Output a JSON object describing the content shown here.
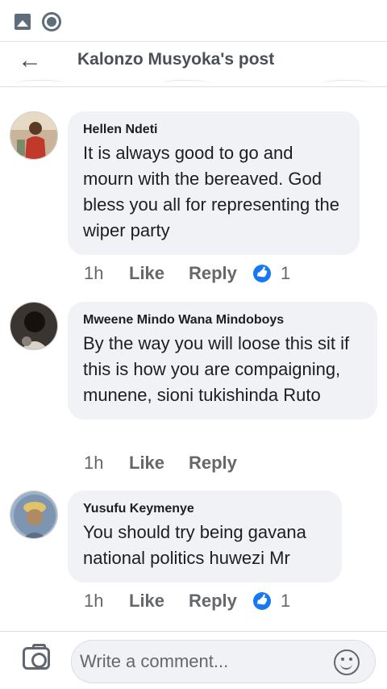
{
  "status_bar": {
    "icons": [
      "gallery-icon",
      "screen-record-icon"
    ]
  },
  "header": {
    "back_icon": "back-arrow-icon",
    "title": "Kalonzo Musyoka's post"
  },
  "comments": [
    {
      "author": "Hellen Ndeti",
      "text": "It is always good to go and mourn with the bereaved. God bless you all for representing the wiper party",
      "time": "1h",
      "like_label": "Like",
      "reply_label": "Reply",
      "reactions": "1"
    },
    {
      "author": "Mweene Mindo Wana Mindoboys",
      "text": "By the way you will loose this sit if this is how you are compaigning, munene, sioni tukishinda Ruto",
      "time": "1h",
      "like_label": "Like",
      "reply_label": "Reply"
    },
    {
      "author": "Yusufu Keymenye",
      "text": "You should try being gavana national politics huwezi Mr",
      "time": "1h",
      "like_label": "Like",
      "reply_label": "Reply",
      "reactions": "1"
    }
  ],
  "composer": {
    "placeholder": "Write a comment...",
    "camera_icon": "camera-icon",
    "emoji_icon": "emoji-icon"
  },
  "colors": {
    "bubble": "#f0f2f5",
    "like_blue": "#1877f2",
    "meta_gray": "#65676b"
  }
}
